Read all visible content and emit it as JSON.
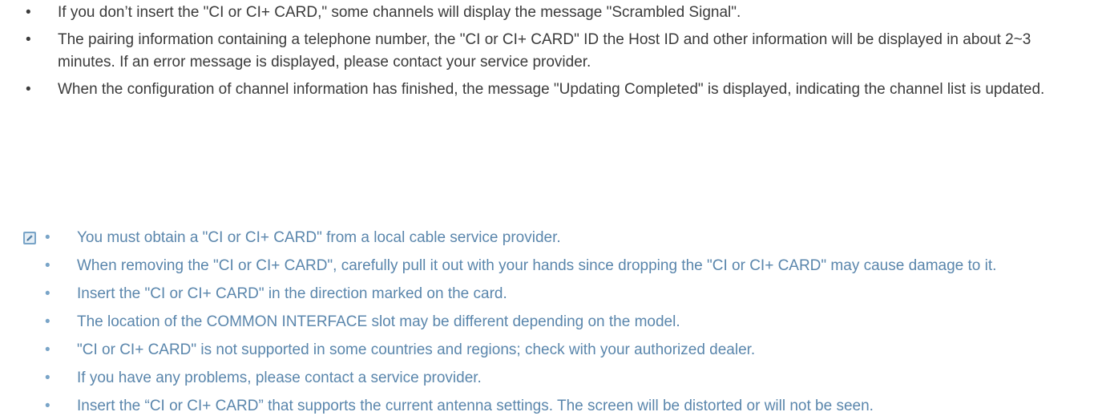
{
  "top_bullets": [
    "If you don’t insert the \"CI or CI+ CARD,\" some channels will display the message \"Scrambled Signal\".",
    "The pairing information containing a telephone number, the \"CI or CI+ CARD\" ID the Host ID and other information will be displayed in about 2~3 minutes. If an error message is displayed, please contact your service provider.",
    "When the configuration of channel information has finished, the message \"Updating Completed\" is displayed, indicating the channel list is updated."
  ],
  "note_icon": "note-pencil-icon",
  "note_bullets": [
    "You must obtain a \"CI or CI+ CARD\" from a local cable service provider.",
    "When removing the \"CI or CI+ CARD\", carefully pull it out with your hands since dropping the \"CI or CI+ CARD\" may cause damage to it.",
    "Insert the \"CI or CI+ CARD\" in the direction marked on the card.",
    "The location of the COMMON INTERFACE slot may be different depending on the model.",
    "\"CI or CI+ CARD\" is not supported in some countries and regions; check with your authorized dealer.",
    "If you have any problems, please contact a service provider.",
    "Insert the “CI or CI+ CARD” that supports the current antenna settings. The screen will be distorted or will not be seen."
  ],
  "colors": {
    "body_text": "#3b3b3b",
    "note_text": "#5a86ac",
    "note_icon_bg": "#7aa5c8"
  }
}
